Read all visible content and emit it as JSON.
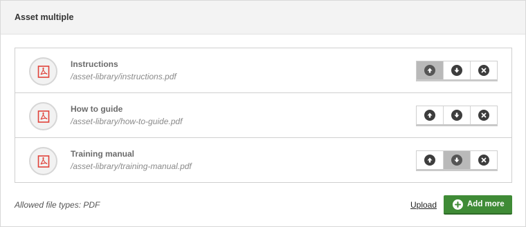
{
  "panel": {
    "title": "Asset multiple"
  },
  "assets": [
    {
      "name": "Instructions",
      "path": "/asset-library/instructions.pdf"
    },
    {
      "name": "How to guide",
      "path": "/asset-library/how-to-guide.pdf"
    },
    {
      "name": "Training manual",
      "path": "/asset-library/training-manual.pdf"
    }
  ],
  "icons": {
    "file": "pdf-icon",
    "up": "arrow-up-icon",
    "down": "arrow-down-icon",
    "remove": "close-icon",
    "add": "plus-icon"
  },
  "colors": {
    "accent": "#3f8b36",
    "pdf": "#e0423a"
  },
  "footer": {
    "allowed_types": "Allowed file types: PDF",
    "upload_label": "Upload",
    "add_more_label": "Add more"
  }
}
